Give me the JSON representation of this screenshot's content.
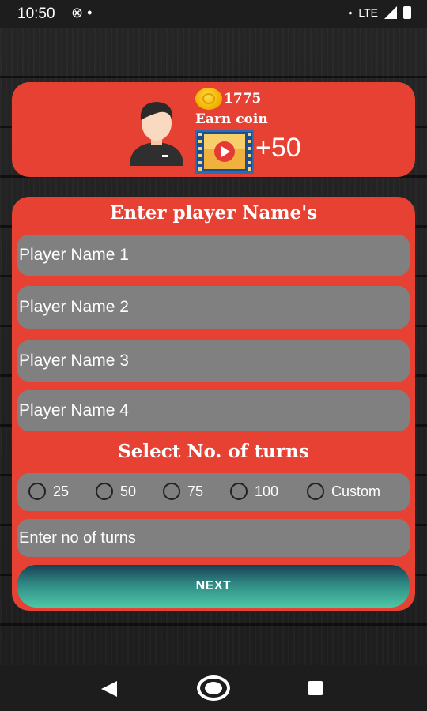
{
  "status_bar": {
    "time": "10:50",
    "network": "LTE"
  },
  "coin_card": {
    "coin_count": "1775",
    "earn_label": "Earn coin",
    "reward": "+50"
  },
  "form": {
    "title": "Enter player Name's",
    "player_fields": [
      {
        "placeholder": "Player Name 1"
      },
      {
        "placeholder": "Player Name 2"
      },
      {
        "placeholder": "Player Name 3"
      },
      {
        "placeholder": "Player Name 4"
      }
    ],
    "turns_title": "Select No. of turns",
    "turn_options": [
      "25",
      "50",
      "75",
      "100",
      "Custom"
    ],
    "custom_turns_placeholder": "Enter no of turns",
    "next_label": "NEXT"
  },
  "colors": {
    "card_red": "#e64133",
    "field_gray": "#808080",
    "coin_gold": "#f4b400",
    "button_teal": "#4cc7a6"
  }
}
